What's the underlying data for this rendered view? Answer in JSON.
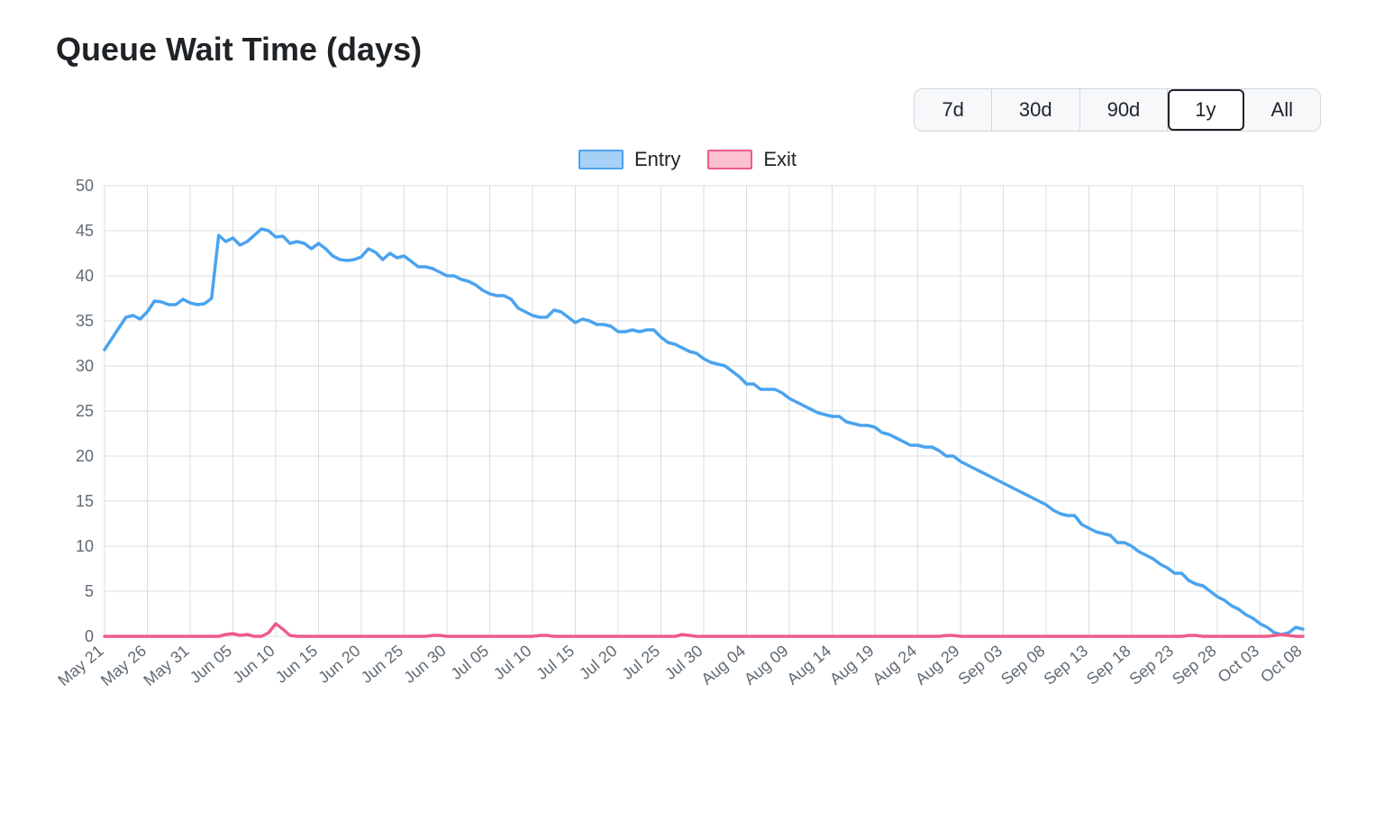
{
  "title": "Queue Wait Time (days)",
  "range_buttons": [
    "7d",
    "30d",
    "90d",
    "1y",
    "All"
  ],
  "range_active_index": 3,
  "legend": {
    "entry": "Entry",
    "exit": "Exit"
  },
  "chart_data": {
    "type": "line",
    "title": "Queue Wait Time (days)",
    "xlabel": "",
    "ylabel": "",
    "ylim": [
      0,
      50
    ],
    "yticks": [
      0,
      5,
      10,
      15,
      20,
      25,
      30,
      35,
      40,
      45,
      50
    ],
    "xticks": [
      "May 21",
      "May 26",
      "May 31",
      "Jun 05",
      "Jun 10",
      "Jun 15",
      "Jun 20",
      "Jun 25",
      "Jun 30",
      "Jul 05",
      "Jul 10",
      "Jul 15",
      "Jul 20",
      "Jul 25",
      "Jul 30",
      "Aug 04",
      "Aug 09",
      "Aug 14",
      "Aug 19",
      "Aug 24",
      "Aug 29",
      "Sep 03",
      "Sep 08",
      "Sep 13",
      "Sep 18",
      "Sep 23",
      "Sep 28",
      "Oct 03",
      "Oct 08"
    ],
    "series": [
      {
        "name": "Entry",
        "color": "#4aa3ef",
        "values": [
          31.8,
          33.0,
          34.2,
          35.4,
          35.6,
          35.2,
          36.0,
          37.2,
          37.1,
          36.8,
          36.8,
          37.4,
          37.0,
          36.8,
          36.9,
          37.5,
          44.5,
          43.8,
          44.2,
          43.4,
          43.8,
          44.5,
          45.2,
          45.0,
          44.3,
          44.4,
          43.6,
          43.8,
          43.6,
          43.0,
          43.6,
          43.0,
          42.2,
          41.8,
          41.7,
          41.8,
          42.1,
          43.0,
          42.6,
          41.8,
          42.5,
          42.0,
          42.2,
          41.6,
          41.0,
          41.0,
          40.8,
          40.4,
          40.0,
          40.0,
          39.6,
          39.4,
          39.0,
          38.4,
          38.0,
          37.8,
          37.8,
          37.4,
          36.4,
          36.0,
          35.6,
          35.4,
          35.4,
          36.2,
          36.0,
          35.4,
          34.8,
          35.2,
          35.0,
          34.6,
          34.6,
          34.4,
          33.8,
          33.8,
          34.0,
          33.8,
          34.0,
          34.0,
          33.2,
          32.6,
          32.4,
          32.0,
          31.6,
          31.4,
          30.8,
          30.4,
          30.2,
          30.0,
          29.4,
          28.8,
          28.0,
          28.0,
          27.4,
          27.4,
          27.4,
          27.0,
          26.4,
          26.0,
          25.6,
          25.2,
          24.8,
          24.6,
          24.4,
          24.4,
          23.8,
          23.6,
          23.4,
          23.4,
          23.2,
          22.6,
          22.4,
          22.0,
          21.6,
          21.2,
          21.2,
          21.0,
          21.0,
          20.6,
          20.0,
          20.0,
          19.4,
          19.0,
          18.6,
          18.2,
          17.8,
          17.4,
          17.0,
          16.6,
          16.2,
          15.8,
          15.4,
          15.0,
          14.6,
          14.0,
          13.6,
          13.4,
          13.4,
          12.4,
          12.0,
          11.6,
          11.4,
          11.2,
          10.4,
          10.4,
          10.0,
          9.4,
          9.0,
          8.6,
          8.0,
          7.6,
          7.0,
          7.0,
          6.2,
          5.8,
          5.6,
          5.0,
          4.4,
          4.0,
          3.4,
          3.0,
          2.4,
          2.0,
          1.4,
          1.0,
          0.4,
          0.2,
          0.4,
          1.0,
          0.8
        ]
      },
      {
        "name": "Exit",
        "color": "#ef5a8b",
        "values": [
          0,
          0,
          0,
          0,
          0,
          0,
          0,
          0,
          0,
          0,
          0,
          0,
          0,
          0,
          0,
          0,
          0,
          0.2,
          0.3,
          0.1,
          0.2,
          0,
          0,
          0.4,
          1.4,
          0.8,
          0.1,
          0,
          0,
          0,
          0,
          0,
          0,
          0,
          0,
          0,
          0,
          0,
          0,
          0,
          0,
          0,
          0,
          0,
          0,
          0,
          0.1,
          0.1,
          0,
          0,
          0,
          0,
          0,
          0,
          0,
          0,
          0,
          0,
          0,
          0,
          0,
          0.1,
          0.1,
          0,
          0,
          0,
          0,
          0,
          0,
          0,
          0,
          0,
          0,
          0,
          0,
          0,
          0,
          0,
          0,
          0,
          0,
          0.2,
          0.1,
          0,
          0,
          0,
          0,
          0,
          0,
          0,
          0,
          0,
          0,
          0,
          0,
          0,
          0,
          0,
          0,
          0,
          0,
          0,
          0,
          0,
          0,
          0,
          0,
          0,
          0,
          0,
          0,
          0,
          0,
          0,
          0,
          0,
          0,
          0,
          0.1,
          0.1,
          0,
          0,
          0,
          0,
          0,
          0,
          0,
          0,
          0,
          0,
          0,
          0,
          0,
          0,
          0,
          0,
          0,
          0,
          0,
          0,
          0,
          0,
          0,
          0,
          0,
          0,
          0,
          0,
          0,
          0,
          0,
          0,
          0.1,
          0.1,
          0,
          0,
          0,
          0,
          0,
          0,
          0,
          0,
          0,
          0,
          0.1,
          0.2,
          0.1,
          0,
          0
        ]
      }
    ]
  }
}
